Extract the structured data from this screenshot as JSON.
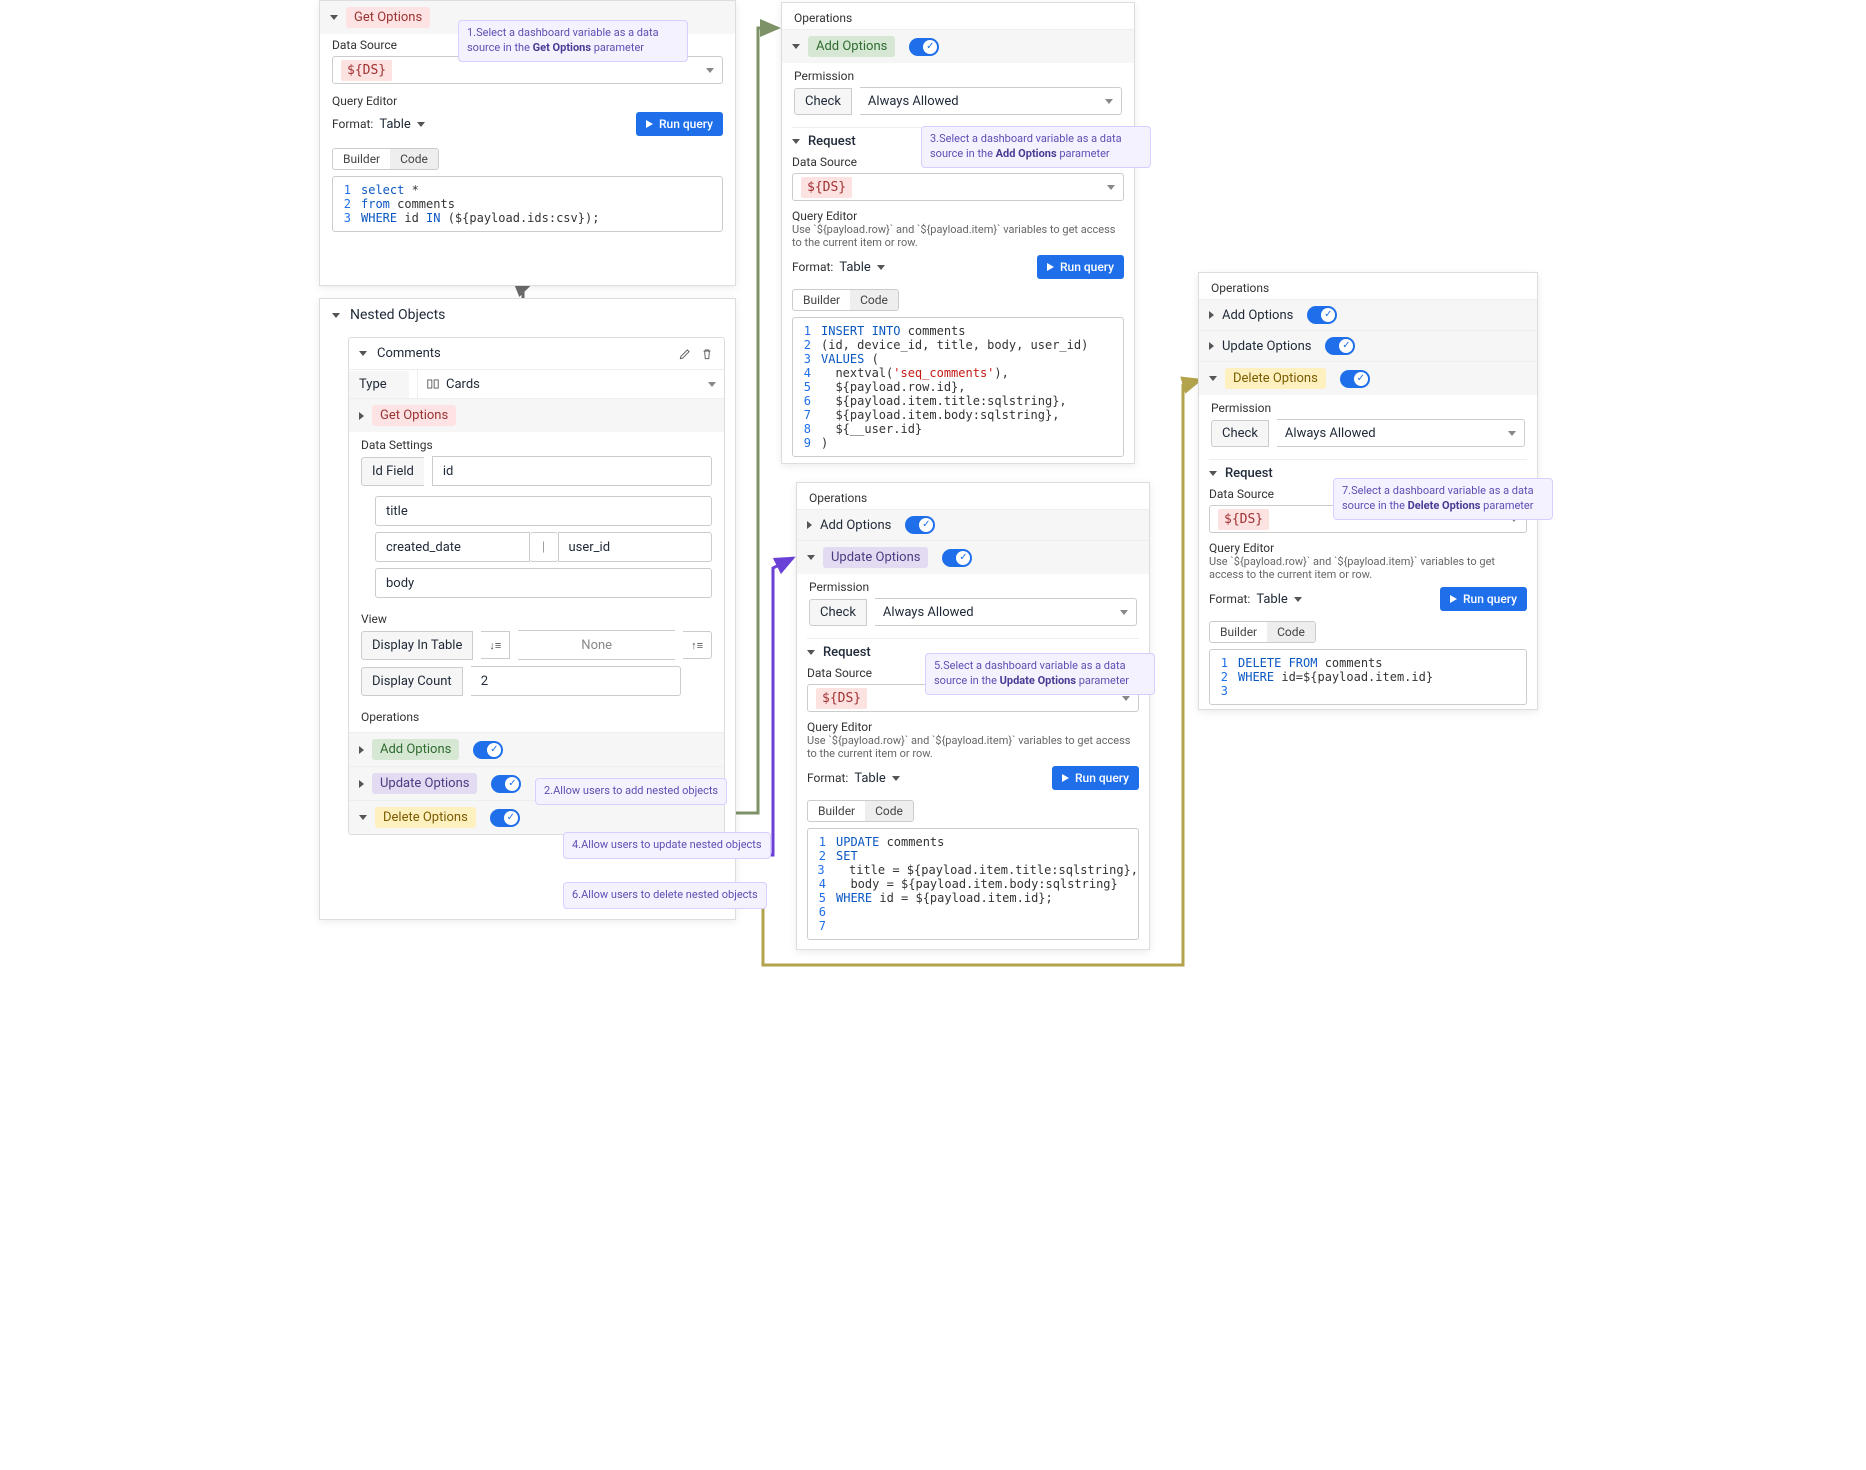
{
  "panel1": {
    "get_options": "Get Options",
    "data_source_label": "Data Source",
    "ds_value": "${DS}",
    "query_editor": "Query Editor",
    "format_label": "Format:",
    "format_value": "Table",
    "run_query": "Run query",
    "tab_builder": "Builder",
    "tab_code": "Code",
    "code": [
      {
        "n": 1,
        "t": [
          {
            "c": "kw",
            "s": "select"
          },
          {
            "c": "var",
            "s": " *"
          }
        ]
      },
      {
        "n": 2,
        "t": [
          {
            "c": "kw",
            "s": "from"
          },
          {
            "c": "var",
            "s": " comments"
          }
        ]
      },
      {
        "n": 3,
        "t": [
          {
            "c": "kw",
            "s": "WHERE"
          },
          {
            "c": "var",
            "s": " id "
          },
          {
            "c": "kw",
            "s": "IN"
          },
          {
            "c": "var",
            "s": " (${payload.ids:csv});"
          }
        ]
      }
    ]
  },
  "panel2": {
    "nested_objects": "Nested Objects",
    "comments": "Comments",
    "type_label": "Type",
    "type_value": "Cards",
    "get_options": "Get Options",
    "data_settings": "Data Settings",
    "id_field_label": "Id Field",
    "id_field_value": "id",
    "fields": [
      "title",
      "created_date",
      "user_id",
      "body"
    ],
    "view": "View",
    "display_in_table": "Display In Table",
    "none": "None",
    "display_count_label": "Display Count",
    "display_count_value": "2",
    "operations": "Operations",
    "add_options": "Add Options",
    "update_options": "Update Options",
    "delete_options": "Delete Options"
  },
  "panel3": {
    "operations": "Operations",
    "add_options": "Add Options",
    "permission": "Permission",
    "check": "Check",
    "always_allowed": "Always Allowed",
    "request": "Request",
    "data_source_label": "Data Source",
    "ds_value": "${DS}",
    "query_editor": "Query Editor",
    "hint": "Use `${payload.row}` and `${payload.item}` variables to get access to the current item or row.",
    "format_label": "Format:",
    "format_value": "Table",
    "run_query": "Run query",
    "tab_builder": "Builder",
    "tab_code": "Code",
    "code": [
      {
        "n": 1,
        "t": [
          {
            "c": "kw",
            "s": "INSERT INTO"
          },
          {
            "c": "var",
            "s": " comments"
          }
        ]
      },
      {
        "n": 2,
        "t": [
          {
            "c": "var",
            "s": "(id, device_id, title, body, user_id)"
          }
        ]
      },
      {
        "n": 3,
        "t": [
          {
            "c": "kw",
            "s": "VALUES"
          },
          {
            "c": "var",
            "s": " ("
          }
        ]
      },
      {
        "n": 4,
        "t": [
          {
            "c": "var",
            "s": "  nextval("
          },
          {
            "c": "str",
            "s": "'seq_comments'"
          },
          {
            "c": "var",
            "s": "),"
          }
        ]
      },
      {
        "n": 5,
        "t": [
          {
            "c": "var",
            "s": "  ${payload.row.id},"
          }
        ]
      },
      {
        "n": 6,
        "t": [
          {
            "c": "var",
            "s": "  ${payload.item.title:sqlstring},"
          }
        ]
      },
      {
        "n": 7,
        "t": [
          {
            "c": "var",
            "s": "  ${payload.item.body:sqlstring},"
          }
        ]
      },
      {
        "n": 8,
        "t": [
          {
            "c": "var",
            "s": "  ${__user.id}"
          }
        ]
      },
      {
        "n": 9,
        "t": [
          {
            "c": "var",
            "s": ")"
          }
        ]
      }
    ]
  },
  "panel4": {
    "operations": "Operations",
    "add_options": "Add Options",
    "update_options": "Update Options",
    "permission": "Permission",
    "check": "Check",
    "always_allowed": "Always Allowed",
    "request": "Request",
    "data_source_label": "Data Source",
    "ds_value": "${DS}",
    "query_editor": "Query Editor",
    "hint": "Use `${payload.row}` and `${payload.item}` variables to get access to the current item or row.",
    "format_label": "Format:",
    "format_value": "Table",
    "run_query": "Run query",
    "tab_builder": "Builder",
    "tab_code": "Code",
    "code": [
      {
        "n": 1,
        "t": [
          {
            "c": "kw",
            "s": "UPDATE"
          },
          {
            "c": "var",
            "s": " comments"
          }
        ]
      },
      {
        "n": 2,
        "t": [
          {
            "c": "kw",
            "s": "SET"
          }
        ]
      },
      {
        "n": 3,
        "t": [
          {
            "c": "var",
            "s": "  title = ${payload.item.title:sqlstring},"
          }
        ]
      },
      {
        "n": 4,
        "t": [
          {
            "c": "var",
            "s": "  body = ${payload.item.body:sqlstring}"
          }
        ]
      },
      {
        "n": 5,
        "t": [
          {
            "c": "kw",
            "s": "WHERE"
          },
          {
            "c": "var",
            "s": " id = ${payload.item.id};"
          }
        ]
      },
      {
        "n": 6,
        "t": []
      },
      {
        "n": 7,
        "t": []
      }
    ]
  },
  "panel5": {
    "operations": "Operations",
    "add_options": "Add Options",
    "update_options": "Update Options",
    "delete_options": "Delete Options",
    "permission": "Permission",
    "check": "Check",
    "always_allowed": "Always Allowed",
    "request": "Request",
    "data_source_label": "Data Source",
    "ds_value": "${DS}",
    "query_editor": "Query Editor",
    "hint": "Use `${payload.row}` and `${payload.item}` variables to get access to the current item or row.",
    "format_label": "Format:",
    "format_value": "Table",
    "run_query": "Run query",
    "tab_builder": "Builder",
    "tab_code": "Code",
    "code": [
      {
        "n": 1,
        "t": [
          {
            "c": "kw",
            "s": "DELETE FROM"
          },
          {
            "c": "var",
            "s": " comments"
          }
        ]
      },
      {
        "n": 2,
        "t": [
          {
            "c": "kw",
            "s": "WHERE"
          },
          {
            "c": "var",
            "s": " id=${payload.item.id}"
          }
        ]
      },
      {
        "n": 3,
        "t": []
      }
    ]
  },
  "tips": {
    "t1": {
      "lead": "1.",
      "text": "Select a dashboard variable as a data source in the ",
      "bold": "Get Options",
      "tail": " parameter"
    },
    "t2": {
      "lead": "2.",
      "text": "Allow users to add nested objects"
    },
    "t3": {
      "lead": "3.",
      "text": "Select a dashboard variable as a data source in the ",
      "bold": "Add Options",
      "tail": " parameter"
    },
    "t4": {
      "lead": "4.",
      "text": "Allow users to update nested objects"
    },
    "t5": {
      "lead": "5.",
      "text": "Select a dashboard variable as a data source in the ",
      "bold": "Update Options",
      "tail": " parameter"
    },
    "t6": {
      "lead": "6.",
      "text": "Allow users to delete nested objects"
    },
    "t7": {
      "lead": "7.",
      "text": "Select a dashboard variable as a data source in the ",
      "bold": "Delete Options",
      "tail": " parameter"
    }
  }
}
